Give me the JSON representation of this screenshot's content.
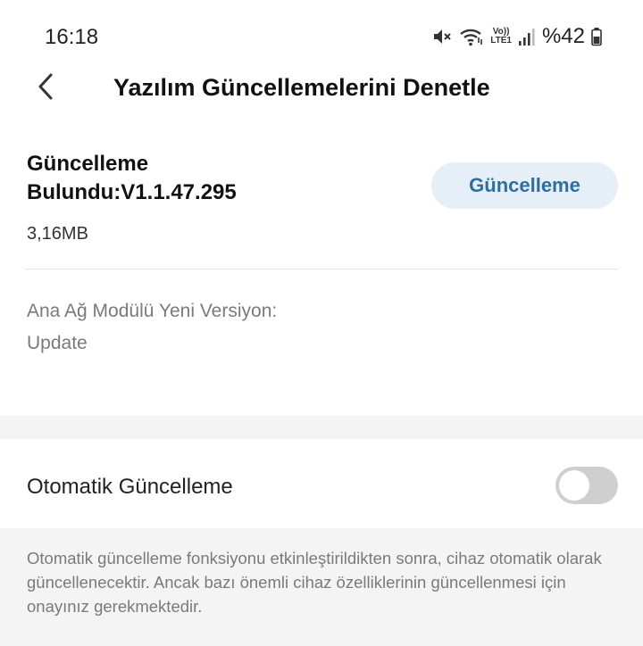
{
  "status_bar": {
    "time": "16:18",
    "network_label_top": "Vo))",
    "network_label_bottom": "LTE1",
    "battery": "%42",
    "icons": [
      "mute-icon",
      "wifi-icon",
      "volte-icon",
      "signal-icon",
      "battery-icon"
    ]
  },
  "header": {
    "title": "Yazılım Güncellemelerini Denetle",
    "back_icon": "chevron-left-icon"
  },
  "update": {
    "title": "Güncelleme Bulundu:V1.1.47.295",
    "size": "3,16MB",
    "button_label": "Güncelleme",
    "module_label": "Ana Ağ Modülü Yeni Versiyon:",
    "module_value": "Update"
  },
  "auto_update": {
    "label": "Otomatik Güncelleme",
    "enabled": false,
    "note": "Otomatik güncelleme fonksiyonu etkinleştirildikten sonra, cihaz otomatik olarak güncellenecektir. Ancak bazı önemli cihaz özelliklerinin güncellenmesi için onayınız gerekmektedir."
  },
  "colors": {
    "accent_text": "#2e6f9e",
    "button_bg": "#e6eff7",
    "section_bg": "#f4f4f4",
    "toggle_off": "#cfcfcf",
    "muted_text": "#7a7a7a"
  }
}
